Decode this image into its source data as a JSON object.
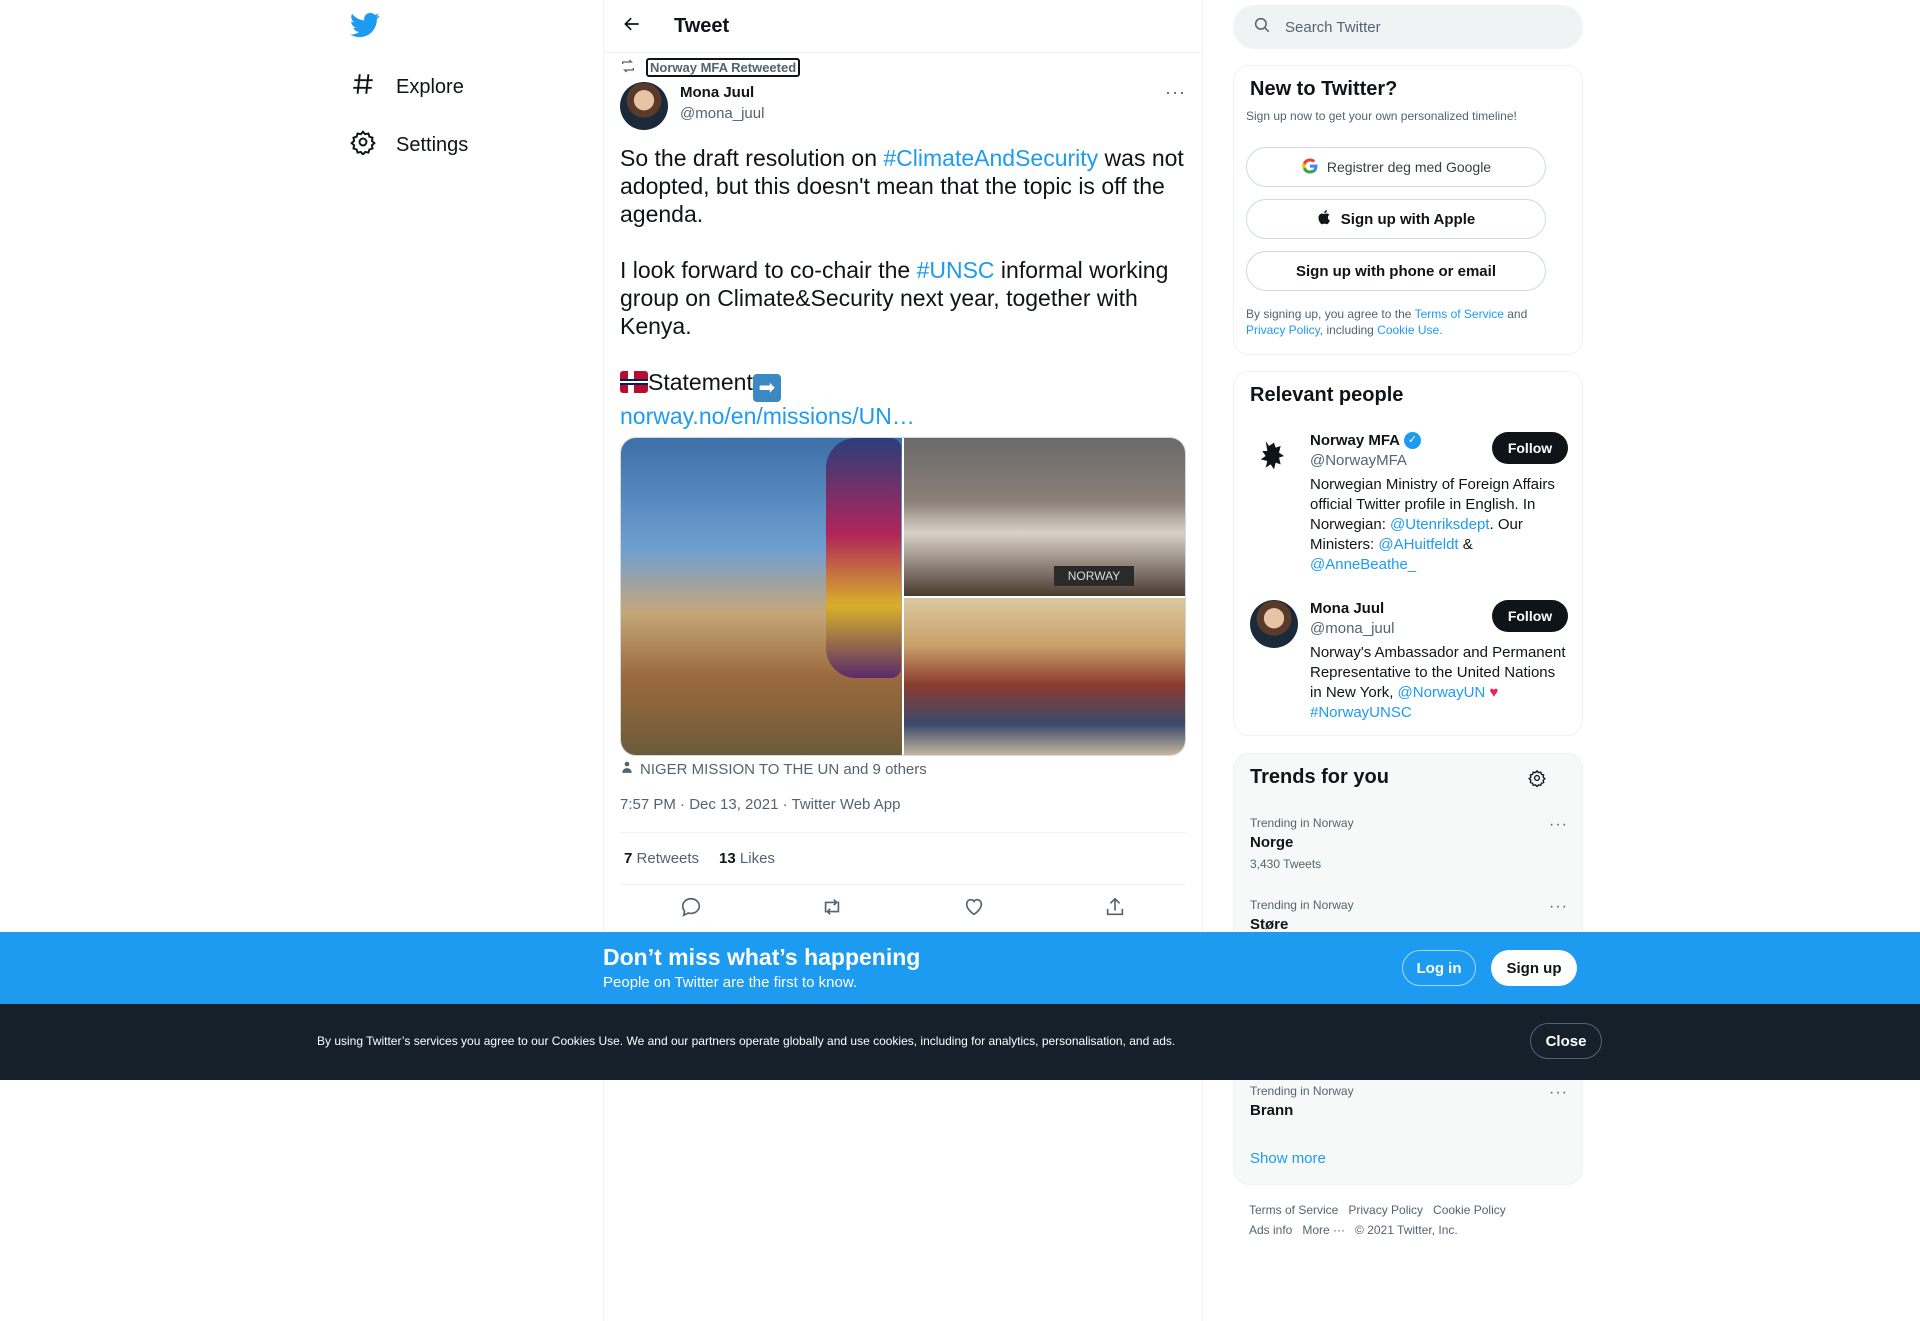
{
  "colors": {
    "brand": "#1d9bf0",
    "text": "#0f1419",
    "muted": "#536471",
    "cookie_bg": "#15202b"
  },
  "nav": {
    "logo": "twitter-bird-icon",
    "items": [
      {
        "label": "Explore",
        "icon": "hashtag-icon"
      },
      {
        "label": "Settings",
        "icon": "gear-icon"
      }
    ]
  },
  "header": {
    "title": "Tweet"
  },
  "tweet": {
    "retweeted_by": "Norway MFA Retweeted",
    "author_name": "Mona Juul",
    "author_handle": "@mona_juul",
    "para1": {
      "a": "So the draft resolution on ",
      "tag": "#ClimateAndSecurity",
      "b": " was not adopted, but this doesn't mean that the topic is off the agenda."
    },
    "para2": {
      "a": "I look forward to co-chair the ",
      "tag": "#UNSC",
      "b": " informal working group on Climate&Security next year, together with Kenya."
    },
    "statement_label": "Statement",
    "link": "norway.no/en/missions/UN…",
    "image_sign_text": "NORWAY",
    "tagged": "NIGER MISSION TO THE UN and 9 others",
    "timestamp": "7:57 PM · Dec 13, 2021 · Twitter Web App",
    "retweets_count": "7",
    "retweets_label": "Retweets",
    "likes_count": "13",
    "likes_label": "Likes"
  },
  "search": {
    "placeholder": "Search Twitter"
  },
  "new_to_twitter": {
    "title": "New to Twitter?",
    "subtitle": "Sign up now to get your own personalized timeline!",
    "google_label": "Registrer deg med Google",
    "apple_label": "Sign up with Apple",
    "phone_label": "Sign up with phone or email",
    "legal_a": "By signing up, you agree to the ",
    "terms": "Terms of Service",
    "legal_b": " and ",
    "privacy": "Privacy Policy",
    "legal_c": ", including ",
    "cookie_use": "Cookie Use."
  },
  "relevant_people": {
    "title": "Relevant people",
    "people": [
      {
        "name": "Norway MFA",
        "handle": "@NorwayMFA",
        "follow_label": "Follow",
        "bio_a": "Norwegian Ministry of Foreign Affairs official Twitter profile in English. In Norwegian: ",
        "mention1": "@Utenriksdept",
        "bio_b": ". Our Ministers: ",
        "mention2": "@AHuitfeldt",
        "bio_c": " & ",
        "mention3": "@AnneBeathe_"
      },
      {
        "name": "Mona Juul",
        "handle": "@mona_juul",
        "follow_label": "Follow",
        "bio_a": "Norway's Ambassador and Permanent Representative to the United Nations in New York, ",
        "mention1": "@NorwayUN",
        "bio_b": " ",
        "mention2": "#NorwayUNSC"
      }
    ]
  },
  "trends": {
    "title": "Trends for you",
    "items": [
      {
        "context": "Trending in Norway",
        "name": "Norge",
        "count": "3,430 Tweets"
      },
      {
        "context": "Trending in Norway",
        "name": "Støre",
        "count": ""
      },
      {
        "context": "Trending in Norway",
        "name": "Brann",
        "count": ""
      }
    ],
    "show_more": "Show more"
  },
  "footer": {
    "links": [
      "Terms of Service",
      "Privacy Policy",
      "Cookie Policy",
      "Ads info",
      "More ···"
    ],
    "copyright": "© 2021 Twitter, Inc."
  },
  "signup_bar": {
    "title": "Don’t miss what’s happening",
    "subtitle": "People on Twitter are the first to know.",
    "login_label": "Log in",
    "signup_label": "Sign up"
  },
  "cookie_bar": {
    "text": "By using Twitter’s services you agree to our Cookies Use. We and our partners operate globally and use cookies, including for analytics, personalisation, and ads.",
    "close_label": "Close"
  }
}
